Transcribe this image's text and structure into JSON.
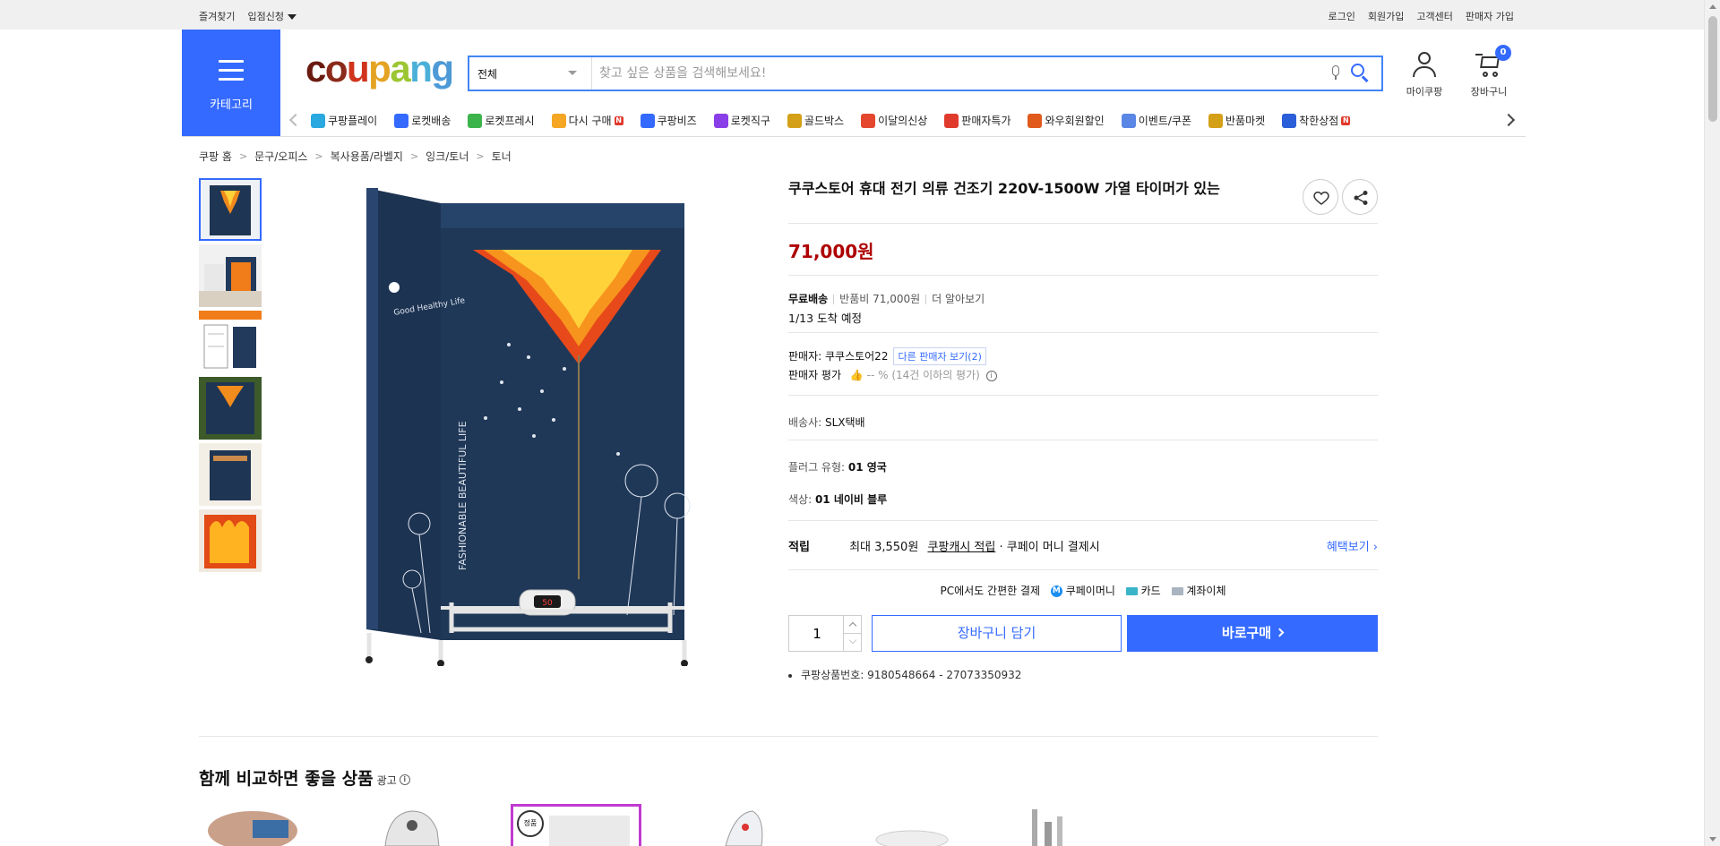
{
  "topbar": {
    "left": [
      "즐겨찾기",
      "입점신청"
    ],
    "right": [
      "로그인",
      "회원가입",
      "고객센터",
      "판매자 가입"
    ]
  },
  "header": {
    "category_label": "카테고리",
    "logo": "coupang",
    "search_scope": "전체",
    "search_placeholder": "찾고 싶은 상품을 검색해보세요!",
    "mypage_label": "마이쿠팡",
    "cart_label": "장바구니",
    "cart_count": "0"
  },
  "nav": {
    "items": [
      {
        "label": "쿠팡플레이",
        "icon": "play-icon",
        "color": "#2aa8e0"
      },
      {
        "label": "로켓배송",
        "icon": "rocket-icon",
        "color": "#346aff"
      },
      {
        "label": "로켓프레시",
        "icon": "rocket-fresh-icon",
        "color": "#3cb44b"
      },
      {
        "label": "다시 구매",
        "icon": "repurchase-icon",
        "color": "#f5a623"
      },
      {
        "label": "쿠팡비즈",
        "icon": "biz-icon",
        "color": "#346aff"
      },
      {
        "label": "로켓직구",
        "icon": "rocket-global-icon",
        "color": "#8a3ee8"
      },
      {
        "label": "골드박스",
        "icon": "goldbox-icon",
        "color": "#d4a017"
      },
      {
        "label": "이달의신상",
        "icon": "new-icon",
        "color": "#e4472d"
      },
      {
        "label": "판매자특가",
        "icon": "percent-icon",
        "color": "#e03a2d"
      },
      {
        "label": "와우회원할인",
        "icon": "wow-icon",
        "color": "#e05a1c"
      },
      {
        "label": "이벤트/쿠폰",
        "icon": "coupon-icon",
        "color": "#5a87e6"
      },
      {
        "label": "반품마켓",
        "icon": "return-market-icon",
        "color": "#d4a017"
      },
      {
        "label": "착한상점",
        "icon": "good-store-icon",
        "color": "#2b5fd9"
      }
    ]
  },
  "breadcrumb": [
    "쿠팡 홈",
    "문구/오피스",
    "복사용품/라벨지",
    "잉크/토너",
    "토너"
  ],
  "product": {
    "title": "쿠쿠스토어 휴대 전기 의류 건조기 220V-1500W 가열 타이머가 있는",
    "price": "71,000원",
    "shipping_free": "무료배송",
    "return_fee": "반품비 71,000원",
    "more": "더 알아보기",
    "arrival": "1/13 도착 예정",
    "seller_label": "판매자: ",
    "seller": "쿠쿠스토어22",
    "other_sellers": "다른 판매자 보기(2)",
    "seller_rating_label": "판매자 평가",
    "seller_rating_value": "-- % (14건 이하의 평가)",
    "carrier_label": "배송사: ",
    "carrier": "SLX택배",
    "plug_label": "플러그 유형: ",
    "plug": "01 영국",
    "color_label": "색상: ",
    "color": "01 네이비 블루",
    "reward_label": "적립",
    "reward_text_1": "최대 3,550원",
    "reward_text_2": "쿠팡캐시 적립",
    "reward_text_3": " · 쿠페이 머니 결제시",
    "reward_link": "혜택보기",
    "easypay_label": "PC에서도 간편한 결제",
    "pay_1": "쿠페이머니",
    "pay_2": "카드",
    "pay_3": "계좌이체",
    "quantity": "1",
    "cart_button": "장바구니 담기",
    "buy_button": "바로구매",
    "product_number": "쿠팡상품번호: 9180548664 - 27073350932"
  },
  "image_text": {
    "vertical": "FASHIONABLE BEAUTIFUL LIFE",
    "brand_left": "Good Healthy Life",
    "display": "50"
  },
  "recommend": {
    "title": "함께 비교하면 좋을 상품",
    "ad": "광고",
    "badge": "정품"
  },
  "colors": {
    "accent": "#346aff",
    "price": "#ae0000",
    "navy": "#1f3554"
  }
}
